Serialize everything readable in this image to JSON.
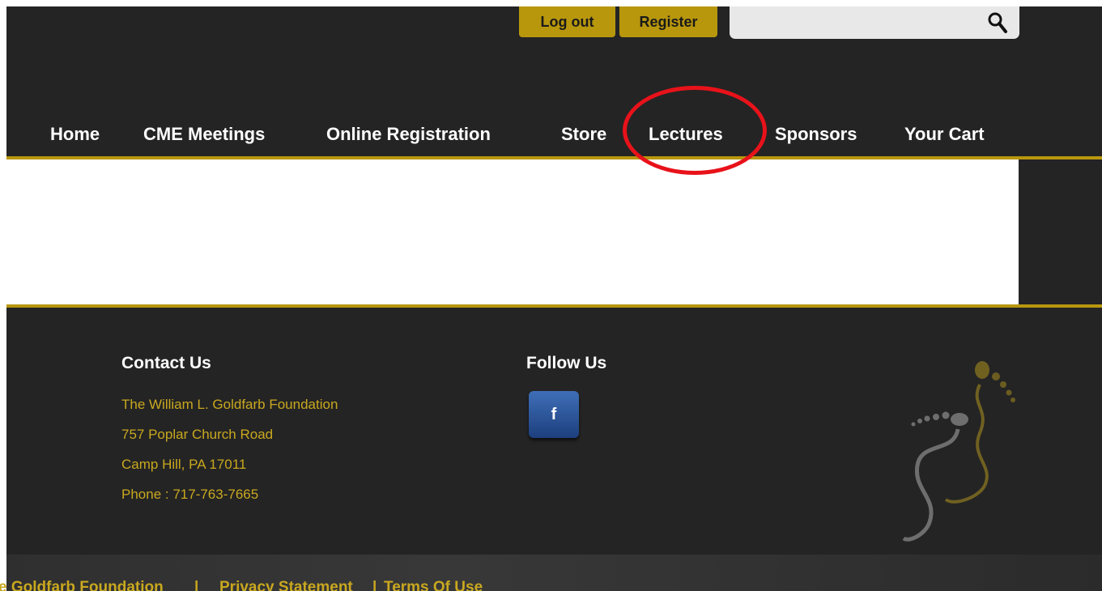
{
  "top_bar": {
    "logout_label": "Log out",
    "register_label": "Register",
    "search_placeholder": ""
  },
  "nav": {
    "items": [
      {
        "label": "Home"
      },
      {
        "label": "CME Meetings"
      },
      {
        "label": "Online Registration"
      },
      {
        "label": "Store"
      },
      {
        "label": "Lectures"
      },
      {
        "label": "Sponsors"
      },
      {
        "label": "Your Cart"
      }
    ]
  },
  "footer": {
    "contact_heading": "Contact Us",
    "contact_lines": [
      "The William L. Goldfarb Foundation",
      "757 Poplar Church Road",
      "Camp Hill, PA 17011",
      "Phone : 717-763-7665"
    ],
    "follow_heading": "Follow Us",
    "facebook_letter": "f"
  },
  "bottom_bar": {
    "foundation_link": "e Goldfarb Foundation",
    "separator": "|",
    "privacy_link": "Privacy Statement",
    "terms_link": "Terms Of Use"
  },
  "colors": {
    "accent_gold": "#b8970d",
    "link_gold": "#c9a81f",
    "dark_bg": "#242424",
    "annotation_red": "#e8121a"
  },
  "icons": [
    "search-icon",
    "facebook-icon",
    "feet-logo"
  ]
}
